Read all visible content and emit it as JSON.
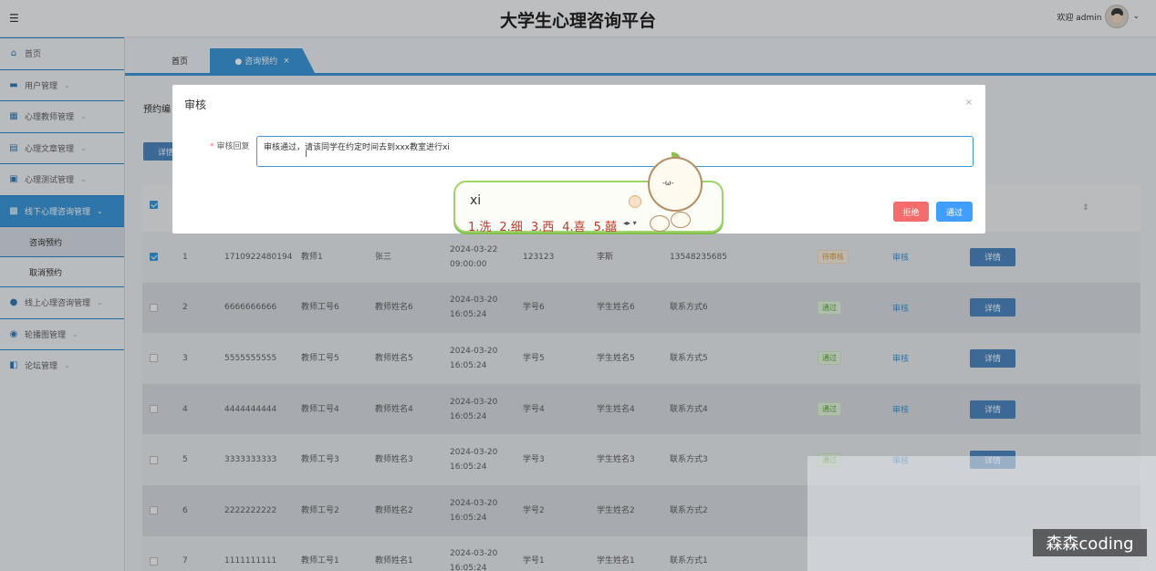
{
  "header": {
    "title": "大学生心理咨询平台",
    "welcome": "欢迎 admin",
    "menu_icon": "hamburger-icon",
    "avatar_icon": "user-avatar",
    "chevron": "⌄"
  },
  "sidebar": {
    "items": [
      {
        "label": "首页",
        "icon": "home-icon",
        "glyph": "⌂"
      },
      {
        "label": "用户管理",
        "icon": "id-card-icon",
        "glyph": "▬"
      },
      {
        "label": "心理教师管理",
        "icon": "grid-icon",
        "glyph": "▦"
      },
      {
        "label": "心理文章管理",
        "icon": "inbox-icon",
        "glyph": "▤"
      },
      {
        "label": "心理测试管理",
        "icon": "monitor-icon",
        "glyph": "▣"
      },
      {
        "label": "线下心理咨询管理",
        "icon": "apps-icon",
        "glyph": "▩"
      },
      {
        "label": "咨询预约"
      },
      {
        "label": "取消预约"
      },
      {
        "label": "线上心理咨询管理",
        "icon": "chat-icon",
        "glyph": "●"
      },
      {
        "label": "轮播图管理",
        "icon": "drop-icon",
        "glyph": "◉"
      },
      {
        "label": "论坛管理",
        "icon": "crop-icon",
        "glyph": "◧"
      }
    ]
  },
  "tabs": [
    {
      "label": "首页"
    },
    {
      "label": "● 咨询预约",
      "close": "×"
    }
  ],
  "content": {
    "search_label": "预约编",
    "detail_button": "详情",
    "sort_icon": "⇕"
  },
  "table": {
    "rows": [
      {
        "no": "1",
        "code": "1710922480194",
        "teacher_id": "教师1",
        "teacher_name": "张三",
        "time": "2024-03-22 09:00:00",
        "student_id": "123123",
        "student_name": "李斯",
        "contact": "13548235685",
        "status": "待审核",
        "audit": "审核",
        "detail": "详情",
        "checked": true
      },
      {
        "no": "2",
        "code": "6666666666",
        "teacher_id": "教师工号6",
        "teacher_name": "教师姓名6",
        "time": "2024-03-20 16:05:24",
        "student_id": "学号6",
        "student_name": "学生姓名6",
        "contact": "联系方式6",
        "status": "通过",
        "audit": "审核",
        "detail": "详情",
        "checked": false
      },
      {
        "no": "3",
        "code": "5555555555",
        "teacher_id": "教师工号5",
        "teacher_name": "教师姓名5",
        "time": "2024-03-20 16:05:24",
        "student_id": "学号5",
        "student_name": "学生姓名5",
        "contact": "联系方式5",
        "status": "通过",
        "audit": "审核",
        "detail": "详情",
        "checked": false
      },
      {
        "no": "4",
        "code": "4444444444",
        "teacher_id": "教师工号4",
        "teacher_name": "教师姓名4",
        "time": "2024-03-20 16:05:24",
        "student_id": "学号4",
        "student_name": "学生姓名4",
        "contact": "联系方式4",
        "status": "通过",
        "audit": "审核",
        "detail": "详情",
        "checked": false
      },
      {
        "no": "5",
        "code": "3333333333",
        "teacher_id": "教师工号3",
        "teacher_name": "教师姓名3",
        "time": "2024-03-20 16:05:24",
        "student_id": "学号3",
        "student_name": "学生姓名3",
        "contact": "联系方式3",
        "status": "通过",
        "audit": "审核",
        "detail": "详情",
        "checked": false
      },
      {
        "no": "6",
        "code": "2222222222",
        "teacher_id": "教师工号2",
        "teacher_name": "教师姓名2",
        "time": "2024-03-20 16:05:24",
        "student_id": "学号2",
        "student_name": "学生姓名2",
        "contact": "联系方式2",
        "status": "",
        "audit": "",
        "detail": "",
        "checked": false
      },
      {
        "no": "7",
        "code": "1111111111",
        "teacher_id": "教师工号1",
        "teacher_name": "教师姓名1",
        "time": "2024-03-20 16:05:24",
        "student_id": "学号1",
        "student_name": "学生姓名1",
        "contact": "联系方式1",
        "status": "",
        "audit": "",
        "detail": "",
        "checked": false
      }
    ]
  },
  "modal": {
    "title": "审核",
    "close": "×",
    "field_required_mark": "*",
    "field_label": "审核回复",
    "reply_value": "审核通过，请该同学在约定时间去到xxx教室进行xi",
    "caret": "I",
    "reject_label": "拒绝",
    "pass_label": "通过"
  },
  "ime": {
    "typed": "xi",
    "candidates": [
      "1.洗",
      "2.细",
      "3.西",
      "4.喜",
      "5.囍"
    ],
    "controls": "◂▸ ▾",
    "mascot_face": "-ω-"
  },
  "watermark": "森森coding"
}
